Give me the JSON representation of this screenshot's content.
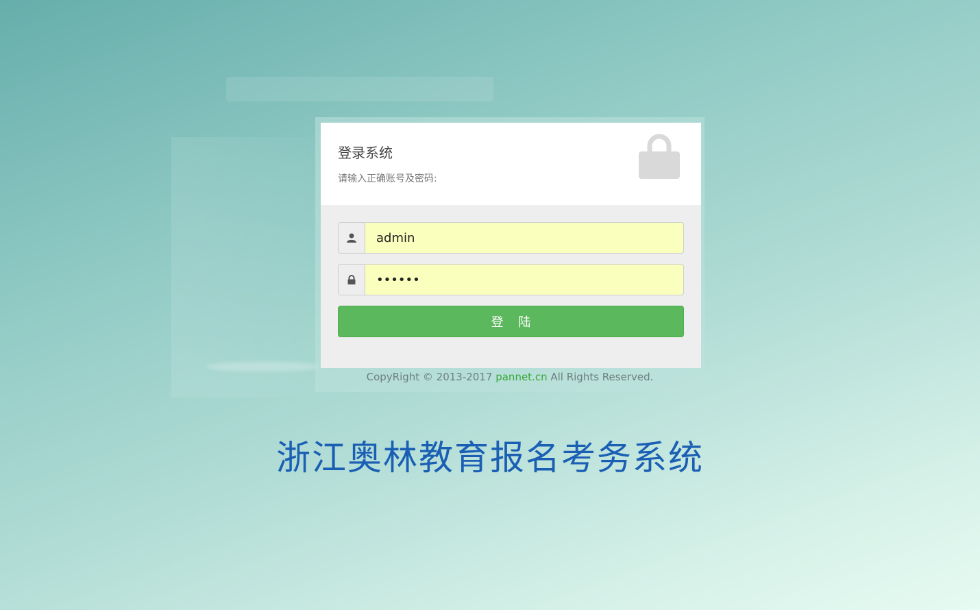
{
  "login_card": {
    "title": "登录系统",
    "subtitle": "请输入正确账号及密码:",
    "header_icon": "lock-icon"
  },
  "form": {
    "username": {
      "icon": "user-icon",
      "value": "admin"
    },
    "password": {
      "icon": "lock-small-icon",
      "value": "••••••"
    },
    "submit_label": "登 陆"
  },
  "footer": {
    "copyright_prefix": "CopyRight © 2013-2017 ",
    "site_link": "pannet.cn",
    "copyright_suffix": " All Rights Reserved."
  },
  "system_name": "浙江奥林教育报名考务系统",
  "colors": {
    "primary_button": "#5cb85c",
    "autofill_bg": "#faffbd",
    "system_name": "#1a5fb4",
    "link": "#3aa63a"
  }
}
